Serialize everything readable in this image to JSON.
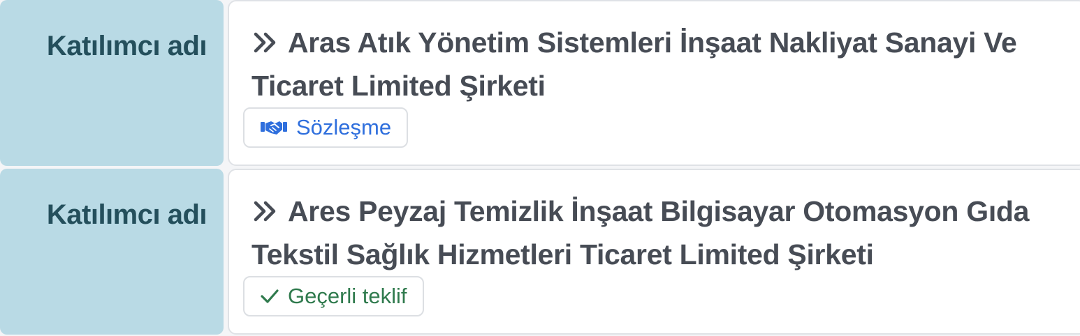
{
  "participants": [
    {
      "label": "Katılımcı adı",
      "name": "Aras Atık Yönetim Sistemleri İnşaat Nakliyat Sanayi Ve Ticaret Limited Şirketi",
      "badge": {
        "text": "Sözleşme",
        "icon": "handshake-icon",
        "color": "#2f6fdd"
      }
    },
    {
      "label": "Katılımcı adı",
      "name": "Ares Peyzaj Temizlik İnşaat Bilgisayar Otomasyon Gıda Tekstil Sağlık Hizmetleri Ticaret Limited Şirketi",
      "badge": {
        "text": "Geçerli teklif",
        "icon": "checkmark-icon",
        "color": "#2f7a4d"
      }
    }
  ],
  "colors": {
    "label_background": "#b9dae5",
    "label_text": "#244f5c",
    "title_text": "#474c55"
  },
  "icons": {
    "title_prefix": "double-chevron-right-icon"
  }
}
